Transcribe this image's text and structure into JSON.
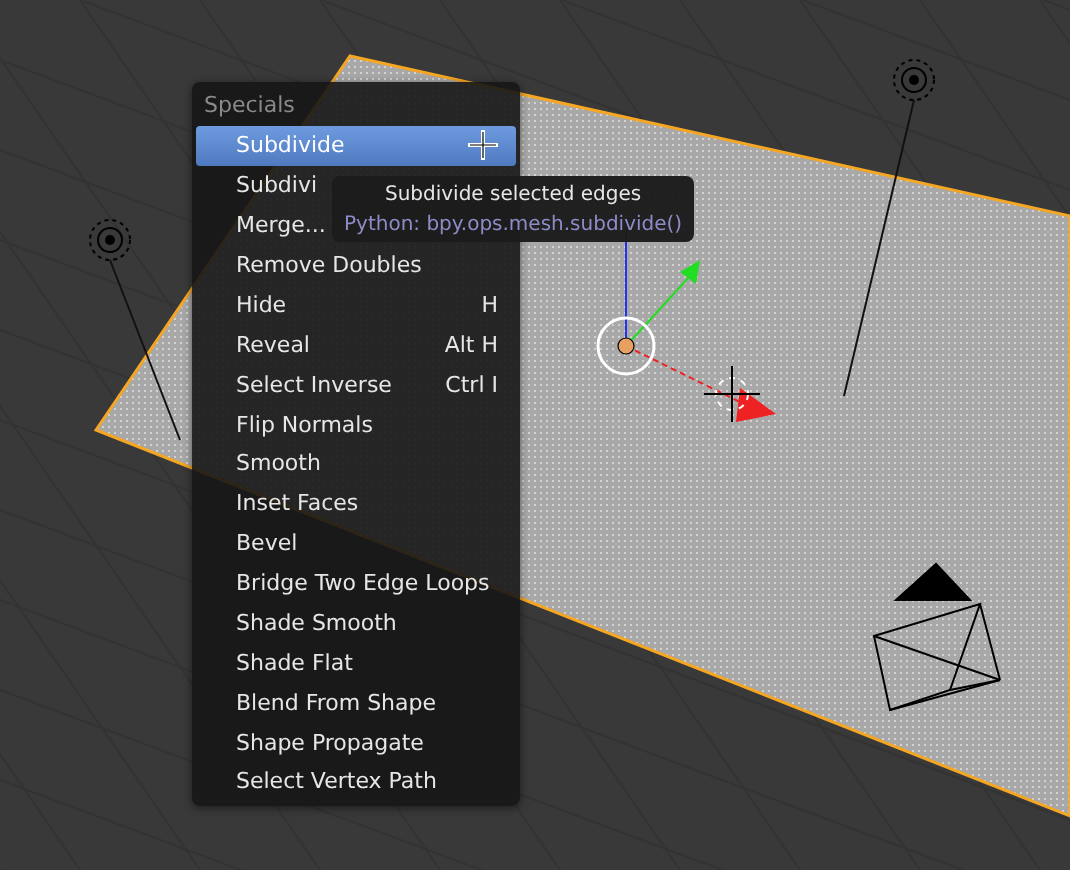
{
  "menu": {
    "title": "Specials",
    "items": [
      {
        "label": "Subdivide",
        "selected": true
      },
      {
        "label": "Subdivi",
        "selected": false
      },
      {
        "label": "Merge...",
        "selected": false
      },
      {
        "label": "Remove Doubles",
        "selected": false
      },
      {
        "label": "Hide",
        "shortcut": "H",
        "selected": false
      },
      {
        "label": "Reveal",
        "shortcut": "Alt H",
        "selected": false
      },
      {
        "label": "Select Inverse",
        "shortcut": "Ctrl I",
        "selected": false
      },
      {
        "label": "Flip Normals",
        "selected": false
      },
      {
        "label": "Smooth",
        "selected": false
      },
      {
        "label": "Inset Faces",
        "selected": false
      },
      {
        "label": "Bevel",
        "selected": false
      },
      {
        "label": "Bridge Two Edge Loops",
        "selected": false
      },
      {
        "label": "Shade Smooth",
        "selected": false
      },
      {
        "label": "Shade Flat",
        "selected": false
      },
      {
        "label": "Blend From Shape",
        "selected": false
      },
      {
        "label": "Shape Propagate",
        "selected": false
      },
      {
        "label": "Select Vertex Path",
        "selected": false
      }
    ]
  },
  "tooltip": {
    "description": "Subdivide selected edges",
    "python": "Python: bpy.ops.mesh.subdivide()"
  }
}
